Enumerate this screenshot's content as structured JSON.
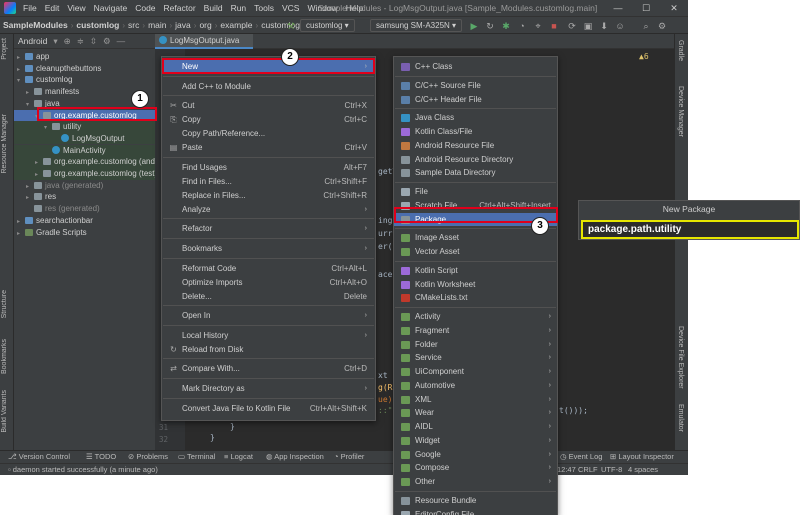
{
  "titlebar": {
    "menu": [
      "File",
      "Edit",
      "View",
      "Navigate",
      "Code",
      "Refactor",
      "Build",
      "Run",
      "Tools",
      "VCS",
      "Window",
      "Help"
    ],
    "window_title": "Sample Modules - LogMsgOutput.java [Sample_Modules.customlog.main]",
    "controls": [
      "—",
      "☐",
      "✕"
    ]
  },
  "navbar": {
    "crumbs": [
      "SampleModules",
      "customlog",
      "src",
      "main",
      "java",
      "org",
      "example",
      "customlog"
    ],
    "run_config": "customlog ▾",
    "device": "samsung SM-A325N ▾"
  },
  "left_strip": {
    "tabs": [
      "Project",
      "Resource Manager",
      "Structure",
      "Bookmarks",
      "Build Variants"
    ]
  },
  "right_strip": {
    "tabs": [
      "Gradle",
      "Device Manager",
      "Device File Explorer",
      "Emulator"
    ]
  },
  "project": {
    "view_mode": "Android",
    "tree": [
      {
        "label": "app",
        "indent": 0,
        "arrow": "›",
        "icon": "folder-b",
        "style": ""
      },
      {
        "label": "cleanupthebuttons",
        "indent": 0,
        "arrow": "›",
        "icon": "folder-b",
        "style": ""
      },
      {
        "label": "customlog",
        "indent": 0,
        "arrow": "⌄",
        "icon": "folder-b",
        "style": ""
      },
      {
        "label": "manifests",
        "indent": 1,
        "arrow": "›",
        "icon": "folder",
        "style": ""
      },
      {
        "label": "java",
        "indent": 1,
        "arrow": "⌄",
        "icon": "folder",
        "style": ""
      },
      {
        "label": "org.example.customlog",
        "indent": 2,
        "arrow": "⌄",
        "icon": "folder",
        "style": "sel"
      },
      {
        "label": "utility",
        "indent": 3,
        "arrow": "⌄",
        "icon": "folder",
        "style": "green"
      },
      {
        "label": "LogMsgOutput",
        "indent": 4,
        "arrow": "",
        "icon": "cls",
        "style": "green"
      },
      {
        "label": "MainActivity",
        "indent": 3,
        "arrow": "",
        "icon": "cls",
        "style": "green"
      },
      {
        "label": "org.example.customlog (andro",
        "indent": 2,
        "arrow": "›",
        "icon": "folder",
        "style": "green"
      },
      {
        "label": "org.example.customlog (test)",
        "indent": 2,
        "arrow": "›",
        "icon": "folder",
        "style": "green"
      },
      {
        "label": "java (generated)",
        "indent": 1,
        "arrow": "›",
        "icon": "folder",
        "style": "gray"
      },
      {
        "label": "res",
        "indent": 1,
        "arrow": "›",
        "icon": "folder",
        "style": ""
      },
      {
        "label": "res (generated)",
        "indent": 1,
        "arrow": "",
        "icon": "folder",
        "style": "gray"
      },
      {
        "label": "searchactionbar",
        "indent": 0,
        "arrow": "›",
        "icon": "folder-b",
        "style": ""
      },
      {
        "label": "Gradle Scripts",
        "indent": 0,
        "arrow": "›",
        "icon": "folder-g",
        "style": ""
      }
    ]
  },
  "editor": {
    "tab_label": "LogMsgOutput.java",
    "line_numbers": [
      "31",
      "32"
    ],
    "code_fragments": [
      "getT",
      "ing",
      "urr",
      "er(",
      "ace",
      "xt",
      "g(R",
      "ue)",
      "::\"",
      "t()));",
      "}",
      "}"
    ],
    "warning_count": "▲6"
  },
  "context_menu": {
    "items": [
      {
        "label": "New",
        "shortcut": "",
        "submenu": true,
        "icon": ""
      },
      {
        "label": "Add C++ to Module",
        "shortcut": "",
        "submenu": false,
        "icon": ""
      },
      {
        "label": "Cut",
        "shortcut": "Ctrl+X",
        "submenu": false,
        "icon": "✂"
      },
      {
        "label": "Copy",
        "shortcut": "Ctrl+C",
        "submenu": false,
        "icon": "⎘"
      },
      {
        "label": "Copy Path/Reference...",
        "shortcut": "",
        "submenu": false,
        "icon": ""
      },
      {
        "label": "Paste",
        "shortcut": "Ctrl+V",
        "submenu": false,
        "icon": "▤"
      },
      {
        "label": "Find Usages",
        "shortcut": "Alt+F7",
        "submenu": false,
        "icon": ""
      },
      {
        "label": "Find in Files...",
        "shortcut": "Ctrl+Shift+F",
        "submenu": false,
        "icon": ""
      },
      {
        "label": "Replace in Files...",
        "shortcut": "Ctrl+Shift+R",
        "submenu": false,
        "icon": ""
      },
      {
        "label": "Analyze",
        "shortcut": "",
        "submenu": true,
        "icon": ""
      },
      {
        "label": "Refactor",
        "shortcut": "",
        "submenu": true,
        "icon": ""
      },
      {
        "label": "Bookmarks",
        "shortcut": "",
        "submenu": true,
        "icon": ""
      },
      {
        "label": "Reformat Code",
        "shortcut": "Ctrl+Alt+L",
        "submenu": false,
        "icon": ""
      },
      {
        "label": "Optimize Imports",
        "shortcut": "Ctrl+Alt+O",
        "submenu": false,
        "icon": ""
      },
      {
        "label": "Delete...",
        "shortcut": "Delete",
        "submenu": false,
        "icon": ""
      },
      {
        "label": "Open In",
        "shortcut": "",
        "submenu": true,
        "icon": ""
      },
      {
        "label": "Local History",
        "shortcut": "",
        "submenu": true,
        "icon": ""
      },
      {
        "label": "Reload from Disk",
        "shortcut": "",
        "submenu": false,
        "icon": "↻"
      },
      {
        "label": "Compare With...",
        "shortcut": "Ctrl+D",
        "submenu": false,
        "icon": "⇄"
      },
      {
        "label": "Mark Directory as",
        "shortcut": "",
        "submenu": true,
        "icon": ""
      },
      {
        "label": "Convert Java File to Kotlin File",
        "shortcut": "Ctrl+Alt+Shift+K",
        "submenu": false,
        "icon": ""
      }
    ]
  },
  "new_submenu": {
    "items": [
      {
        "label": "C++ Class",
        "shortcut": "",
        "submenu": false,
        "color": "#7a5fb0"
      },
      {
        "label": "C/C++ Source File",
        "shortcut": "",
        "submenu": false,
        "color": "#5a7fa8"
      },
      {
        "label": "C/C++ Header File",
        "shortcut": "",
        "submenu": false,
        "color": "#5a7fa8"
      },
      {
        "label": "Java Class",
        "shortcut": "",
        "submenu": false,
        "color": "#3592c4"
      },
      {
        "label": "Kotlin Class/File",
        "shortcut": "",
        "submenu": false,
        "color": "#9c6ad8"
      },
      {
        "label": "Android Resource File",
        "shortcut": "",
        "submenu": false,
        "color": "#c07840"
      },
      {
        "label": "Android Resource Directory",
        "shortcut": "",
        "submenu": false,
        "color": "#87939a"
      },
      {
        "label": "Sample Data Directory",
        "shortcut": "",
        "submenu": false,
        "color": "#87939a"
      },
      {
        "label": "File",
        "shortcut": "",
        "submenu": false,
        "color": "#9aa7b0"
      },
      {
        "label": "Scratch File",
        "shortcut": "Ctrl+Alt+Shift+Insert",
        "submenu": false,
        "color": "#9aa7b0"
      },
      {
        "label": "Package",
        "shortcut": "",
        "submenu": false,
        "color": "#87939a"
      },
      {
        "label": "Image Asset",
        "shortcut": "",
        "submenu": false,
        "color": "#6a9955"
      },
      {
        "label": "Vector Asset",
        "shortcut": "",
        "submenu": false,
        "color": "#6a9955"
      },
      {
        "label": "Kotlin Script",
        "shortcut": "",
        "submenu": false,
        "color": "#9c6ad8"
      },
      {
        "label": "Kotlin Worksheet",
        "shortcut": "",
        "submenu": false,
        "color": "#9c6ad8"
      },
      {
        "label": "CMakeLists.txt",
        "shortcut": "",
        "submenu": false,
        "color": "#c0392b"
      },
      {
        "label": "Activity",
        "shortcut": "",
        "submenu": true,
        "color": "#6a9955"
      },
      {
        "label": "Fragment",
        "shortcut": "",
        "submenu": true,
        "color": "#6a9955"
      },
      {
        "label": "Folder",
        "shortcut": "",
        "submenu": true,
        "color": "#6a9955"
      },
      {
        "label": "Service",
        "shortcut": "",
        "submenu": true,
        "color": "#6a9955"
      },
      {
        "label": "UiComponent",
        "shortcut": "",
        "submenu": true,
        "color": "#6a9955"
      },
      {
        "label": "Automotive",
        "shortcut": "",
        "submenu": true,
        "color": "#6a9955"
      },
      {
        "label": "XML",
        "shortcut": "",
        "submenu": true,
        "color": "#6a9955"
      },
      {
        "label": "Wear",
        "shortcut": "",
        "submenu": true,
        "color": "#6a9955"
      },
      {
        "label": "AIDL",
        "shortcut": "",
        "submenu": true,
        "color": "#6a9955"
      },
      {
        "label": "Widget",
        "shortcut": "",
        "submenu": true,
        "color": "#6a9955"
      },
      {
        "label": "Google",
        "shortcut": "",
        "submenu": true,
        "color": "#6a9955"
      },
      {
        "label": "Compose",
        "shortcut": "",
        "submenu": true,
        "color": "#6a9955"
      },
      {
        "label": "Other",
        "shortcut": "",
        "submenu": true,
        "color": "#6a9955"
      },
      {
        "label": "Resource Bundle",
        "shortcut": "",
        "submenu": false,
        "color": "#87939a"
      },
      {
        "label": "EditorConfig File",
        "shortcut": "",
        "submenu": false,
        "color": "#9aa7b0"
      }
    ]
  },
  "new_package_dialog": {
    "title": "New Package",
    "value": "package.path.utility"
  },
  "callouts": [
    "1",
    "2",
    "3"
  ],
  "status_tabs": [
    "Version Control",
    "TODO",
    "Problems",
    "Terminal",
    "Logcat",
    "App Inspection",
    "Profiler",
    "Event Log",
    "Layout Inspector"
  ],
  "status_right": [
    "12:47",
    "CRLF",
    "UTF-8",
    "4 spaces"
  ],
  "message": "daemon started successfully (a minute ago)",
  "colors": {
    "accent": "#4b6eaf",
    "highlight_box": "#e0001b",
    "dialog_border": "#e6e600"
  }
}
